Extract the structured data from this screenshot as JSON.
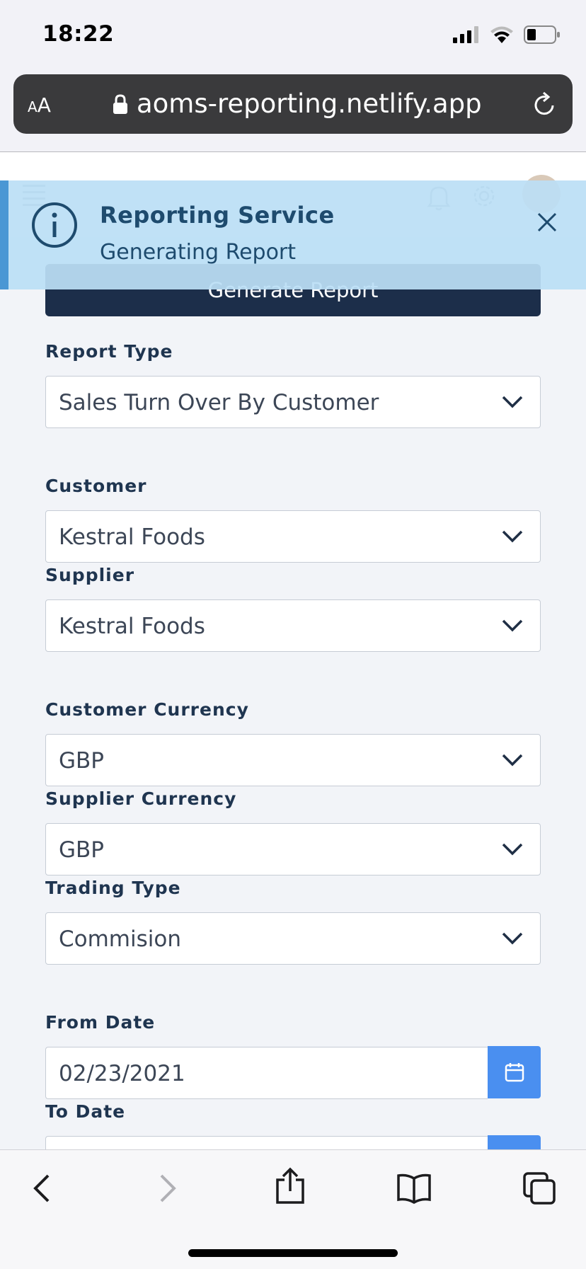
{
  "status_bar": {
    "time": "18:22"
  },
  "browser": {
    "aa_label": "AA",
    "url": "aoms-reporting.netlify.app"
  },
  "toast": {
    "title": "Reporting Service",
    "message": "Generating Report"
  },
  "form": {
    "generate_button": "Generate Report",
    "report_type": {
      "label": "Report Type",
      "value": "Sales Turn Over By Customer"
    },
    "customer": {
      "label": "Customer",
      "value": "Kestral Foods"
    },
    "supplier": {
      "label": "Supplier",
      "value": "Kestral Foods"
    },
    "customer_currency": {
      "label": "Customer Currency",
      "value": "GBP"
    },
    "supplier_currency": {
      "label": "Supplier Currency",
      "value": "GBP"
    },
    "trading_type": {
      "label": "Trading Type",
      "value": "Commision"
    },
    "from_date": {
      "label": "From Date",
      "value": "02/23/2021"
    },
    "to_date": {
      "label": "To Date",
      "value": ""
    }
  },
  "colors": {
    "primary": "#1c2e4a",
    "accent": "#4a8ff0",
    "toast_bg": "#bbdff5",
    "toast_border": "#4a97d4"
  },
  "icons": [
    "signal-icon",
    "wifi-icon",
    "battery-icon",
    "lock-icon",
    "reload-icon",
    "menu-icon",
    "bell-icon",
    "gear-icon",
    "info-icon",
    "close-icon",
    "chevron-down-icon",
    "calendar-icon",
    "back-icon",
    "forward-icon",
    "share-icon",
    "bookmarks-icon",
    "tabs-icon"
  ]
}
